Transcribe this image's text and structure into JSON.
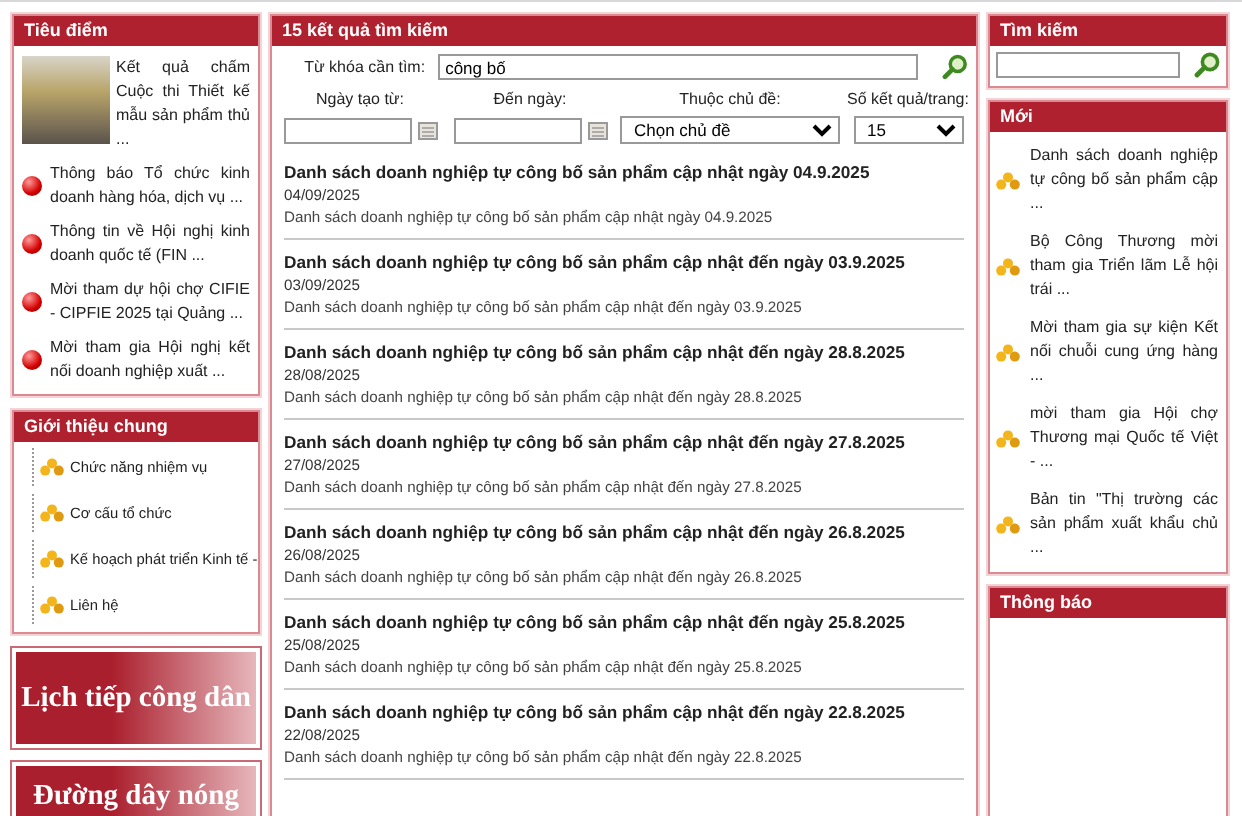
{
  "highlights": {
    "title": "Tiêu điểm",
    "featured": {
      "text": "Kết quả chấm Cuộc thi Thiết kế mẫu sản phẩm thủ ..."
    },
    "items": [
      "Thông báo Tổ chức kinh doanh hàng hóa, dịch vụ ...",
      "Thông tin về Hội nghị kinh doanh quốc tế (FIN ...",
      "Mời tham dự hội chợ CIFIE - CIPFIE 2025 tại Quảng ...",
      "Mời tham gia Hội nghị kết nối doanh nghiệp xuất ..."
    ]
  },
  "intro": {
    "title": "Giới thiệu chung",
    "items": [
      "Chức năng nhiệm vụ",
      "Cơ cấu tổ chức",
      "Kế hoạch phát triển Kinh tế -",
      "Liên hệ"
    ]
  },
  "banners": [
    "Lịch tiếp công dân",
    "Đường dây nóng"
  ],
  "search_results": {
    "title": "15 kết quả tìm kiếm",
    "keyword_label": "Từ khóa cần tìm:",
    "keyword_value": "công bố",
    "filters": [
      {
        "kind": "date",
        "label": "Ngày tạo từ:"
      },
      {
        "kind": "date",
        "label": "Đến ngày:"
      },
      {
        "kind": "select",
        "label": "Thuộc chủ đề:",
        "value": "Chọn chủ đề"
      },
      {
        "kind": "select",
        "label": "Số kết quả/trang:",
        "value": "15"
      }
    ],
    "results": [
      {
        "title": "Danh sách doanh nghiệp tự công bố sản phẩm cập nhật ngày 04.9.2025",
        "date": "04/09/2025",
        "summary": "Danh sách doanh nghiệp tự công bố sản phẩm cập nhật ngày 04.9.2025"
      },
      {
        "title": "Danh sách doanh nghiệp tự công bố sản phẩm cập nhật đến ngày 03.9.2025",
        "date": "03/09/2025",
        "summary": "Danh sách doanh nghiệp tự công bố sản phẩm cập nhật đến ngày 03.9.2025"
      },
      {
        "title": "Danh sách doanh nghiệp tự công bố sản phẩm cập nhật đến ngày 28.8.2025",
        "date": "28/08/2025",
        "summary": "Danh sách doanh nghiệp tự công bố sản phẩm cập nhật đến ngày 28.8.2025"
      },
      {
        "title": "Danh sách doanh nghiệp tự công bố sản phẩm cập nhật đến ngày 27.8.2025",
        "date": "27/08/2025",
        "summary": "Danh sách doanh nghiệp tự công bố sản phẩm cập nhật đến ngày 27.8.2025"
      },
      {
        "title": "Danh sách doanh nghiệp tự công bố sản phẩm cập nhật đến ngày 26.8.2025",
        "date": "26/08/2025",
        "summary": "Danh sách doanh nghiệp tự công bố sản phẩm cập nhật đến ngày 26.8.2025"
      },
      {
        "title": "Danh sách doanh nghiệp tự công bố sản phẩm cập nhật đến ngày 25.8.2025",
        "date": "25/08/2025",
        "summary": "Danh sách doanh nghiệp tự công bố sản phẩm cập nhật đến ngày 25.8.2025"
      },
      {
        "title": "Danh sách doanh nghiệp tự công bố sản phẩm cập nhật đến ngày 22.8.2025",
        "date": "22/08/2025",
        "summary": "Danh sách doanh nghiệp tự công bố sản phẩm cập nhật đến ngày 22.8.2025"
      }
    ]
  },
  "site_search": {
    "title": "Tìm kiếm"
  },
  "news": {
    "title": "Mới",
    "items": [
      "Danh sách doanh nghiệp tự công bố sản phẩm cập ...",
      "Bộ Công Thương mời tham gia Triển lãm Lễ hội trái ...",
      "Mời tham gia sự kiện Kết nối chuỗi cung ứng hàng ...",
      "mời tham gia Hội chợ Thương mại Quốc tế Việt - ...",
      "Bản tin \"Thị trường các sản phẩm xuất khẩu chủ ..."
    ]
  },
  "notices": {
    "title": "Thông báo"
  }
}
